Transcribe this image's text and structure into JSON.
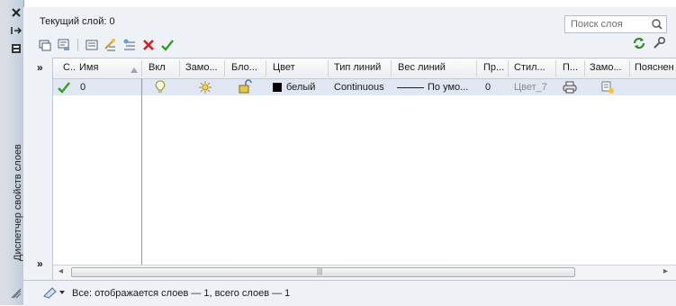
{
  "palette": {
    "title": "Диспетчер свойств слоев",
    "current_layer": "Текущий слой: 0",
    "search_placeholder": "Поиск слоя"
  },
  "table": {
    "columns": [
      "С..",
      "Имя",
      "Вкл",
      "Замо...",
      "Бло...",
      "Цвет",
      "Тип линий",
      "Вес линий",
      "Пр...",
      "Стил...",
      "П...",
      "Замо...",
      "Пояснен"
    ],
    "rows": [
      {
        "status": "current",
        "name": "0",
        "color": "белый",
        "color_hex": "#000000",
        "linetype": "Continuous",
        "lineweight": "По умо...",
        "transparency": "0",
        "plotstyle": "Цвет_7"
      }
    ]
  },
  "status_text": "Все: отображается слоев — 1, всего слоев — 1",
  "icons": {
    "close": "close-icon",
    "autohide": "autohide-icon",
    "properties": "properties-icon",
    "search": "search-icon",
    "refresh": "refresh-icon",
    "settings": "settings-icon"
  },
  "colors": {
    "accent_green": "#3a9a2a",
    "delete_red": "#d32020",
    "row_selected": "#dfe7f3"
  }
}
